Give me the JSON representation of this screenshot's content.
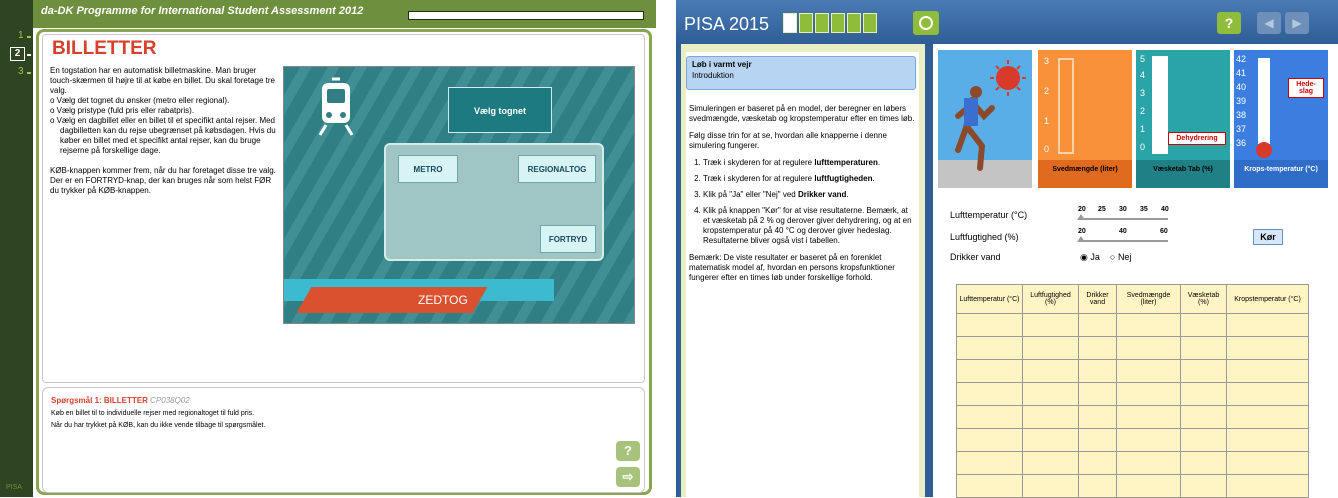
{
  "left": {
    "title_bar": "da-DK Programme for International Student Assessment 2012",
    "question_nav": [
      "1",
      "2",
      "3"
    ],
    "heading": "BILLETTER",
    "intro": [
      "En togstation har en automatisk billetmaskine. Man bruger touch-skærmen til højre til at købe en billet. Du skal foretage tre valg."
    ],
    "steps": [
      "o Vælg det tognet du ønsker (metro eller regional).",
      "o Vælg pristype (fuld pris eller rabatpris).",
      "o Vælg en dagbillet eller en billet til et specifikt antal rejser. Med dagbilletten kan du rejse ubegrænset på købsdagen. Hvis du køber en billet med et specifikt antal rejser, kan du bruge rejserne på forskellige dage."
    ],
    "note": "KØB-knappen kommer frem, når du har foretaget disse tre valg. Der er en FORTRYD-knap, der kan bruges når som helst FØR du trykker på KØB-knappen.",
    "sim": {
      "choose_label": "Vælg tognet",
      "metro_label": "METRO",
      "regional_label": "REGIONALTOG",
      "undo_label": "FORTRYD",
      "brand": "ZEDTOG"
    },
    "question": {
      "title": "Spørgsmål 1: BILLETTER",
      "code": "CP038Q02",
      "lines": [
        "Køb en billet til to individuelle rejser med regionaltoget til fuld pris.",
        "Når du har trykket på KØB, kan du ikke vende tilbage til spørgsmålet."
      ]
    },
    "help_icon": "?",
    "next_icon": "⇨",
    "footer_logo": "PISA"
  },
  "right": {
    "app_title": "PISA 2015",
    "progress_boxes": [
      true,
      false,
      false,
      false,
      false,
      false
    ],
    "help_icon": "?",
    "tab_title": "Løb i varmt vejr",
    "tab_subtitle": "Introduktion",
    "para1": "Simuleringen er baseret på en model, der beregner en løbers svedmængde, væsketab og kropstemperatur efter en times løb.",
    "para2": "Følg disse trin for at se, hvordan alle knapperne i denne simulering fungerer.",
    "steps": [
      {
        "pre": "Træk i skyderen for at regulere ",
        "bold": "lufttemperaturen",
        "post": "."
      },
      {
        "pre": "Træk i skyderen for at regulere ",
        "bold": "luftfugtigheden",
        "post": "."
      },
      {
        "pre": "Klik på \"Ja\" eller \"Nej\" ved ",
        "bold": "Drikker vand",
        "post": "."
      },
      {
        "pre": "Klik på knappen \"Kør\" for at vise resultaterne. Bemærk, at et væsketab på 2 % og derover giver dehydrering, og at en kropstemperatur på 40 °C og derover giver hedeslag. Resultaterne bliver også vist i tabellen.",
        "bold": "",
        "post": ""
      }
    ],
    "note": "Bemærk: De viste resultater er baseret på en forenklet matematisk model af, hvordan en persons kropsfunktioner fungerer efter en times løb under forskellige forhold.",
    "gauges": {
      "sweat_ticks": [
        "3",
        "2",
        "1",
        "0"
      ],
      "sweat_label": "Svedmængde (liter)",
      "fluid_ticks": [
        "5",
        "4",
        "3",
        "2",
        "1",
        "0"
      ],
      "fluid_label": "Væsketab Tab (%)",
      "dehydration": "Dehydrering",
      "temp_ticks": [
        "42",
        "41",
        "40",
        "39",
        "38",
        "37",
        "36"
      ],
      "temp_label": "Krops-temperatur (°C)",
      "heatstroke": "Hede-slag"
    },
    "controls": {
      "air_temp_label": "Lufttemperatur (°C)",
      "air_temp_ticks": [
        "20",
        "25",
        "30",
        "35",
        "40"
      ],
      "humidity_label": "Luftfugtighed (%)",
      "humidity_ticks": [
        "20",
        "40",
        "60"
      ],
      "drink_label": "Drikker vand",
      "yes": "Ja",
      "no": "Nej",
      "yes_selected": true,
      "run": "Kør"
    },
    "table_headers": [
      "Lufttemperatur (°C)",
      "Luftfugtighed (%)",
      "Drikker vand",
      "Svedmængde (liter)",
      "Væsketab (%)",
      "Kropstemperatur (°C)"
    ],
    "table_rows": 8
  }
}
